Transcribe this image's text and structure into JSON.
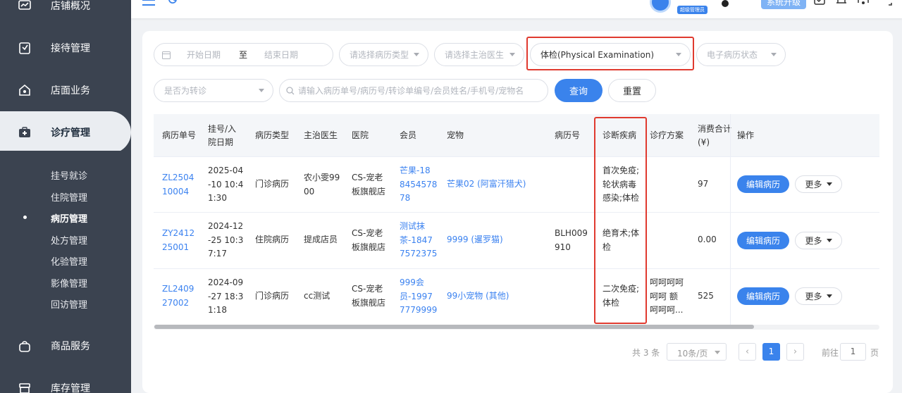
{
  "sidebar": {
    "items": [
      {
        "label": "店铺概况",
        "icon": "dashboard-icon"
      },
      {
        "label": "接待管理",
        "icon": "clipboard-icon"
      },
      {
        "label": "店面业务",
        "icon": "shop-icon"
      },
      {
        "label": "诊疗管理",
        "icon": "medical-kit-icon"
      },
      {
        "label": "商品服务",
        "icon": "bag-icon"
      },
      {
        "label": "库存管理",
        "icon": "box-icon"
      }
    ],
    "sub_items": [
      "挂号就诊",
      "住院管理",
      "病历管理",
      "处方管理",
      "化验管理",
      "影像管理",
      "回访管理"
    ]
  },
  "topbar": {
    "role_badge": "超级管理员",
    "upgrade_label": "系统升级"
  },
  "filters": {
    "start_date": "开始日期",
    "date_sep": "至",
    "end_date": "结束日期",
    "record_type": "请选择病历类型",
    "doctor": "请选择主治医生",
    "exam_type": "体检(Physical Examination)",
    "emr_status": "电子病历状态",
    "transfer": "是否为转诊",
    "search_placeholder": "请输入病历单号/病历号/转诊单编号/会员姓名/手机号/宠物名",
    "query_label": "查询",
    "reset_label": "重置"
  },
  "table": {
    "headers": {
      "record_no": "病历单号",
      "reg_date_1": "挂号/入",
      "reg_date_2": "院日期",
      "type": "病历类型",
      "doctor": "主治医生",
      "hospital": "医院",
      "member": "会员",
      "pet": "宠物",
      "case_no": "病历号",
      "diagnosis": "诊断疾病",
      "plan": "诊疗方案",
      "total_1": "消费合计",
      "total_2": "(¥)",
      "ops": "操作"
    },
    "rows": [
      {
        "record_no": [
          "ZL2504",
          "10004"
        ],
        "date": [
          "2025-04",
          "-10 10:4",
          "1:30"
        ],
        "type": "门诊病历",
        "doctor": [
          "农小雯99",
          "00"
        ],
        "hospital": [
          "CS-宠老",
          "板旗舰店"
        ],
        "member": [
          "芒果-18",
          "8454578",
          "78"
        ],
        "pet": "芒果02 (阿富汗猎犬)",
        "case_no": [
          "",
          ""
        ],
        "diagnosis": [
          "首次免疫;",
          "轮状病毒",
          "感染;体检"
        ],
        "plan": [
          "",
          "",
          ""
        ],
        "total": "97",
        "edit_label": "编辑病历",
        "more_label": "更多"
      },
      {
        "record_no": [
          "ZY2412",
          "25001"
        ],
        "date": [
          "2024-12",
          "-25 10:3",
          "7:17"
        ],
        "type": "住院病历",
        "doctor": [
          "提成店员",
          ""
        ],
        "hospital": [
          "CS-宠老",
          "板旗舰店"
        ],
        "member": [
          "测试抹",
          "茶-1847",
          "7572375"
        ],
        "pet": "9999 (暹罗猫)",
        "case_no": [
          "BLH009",
          "910"
        ],
        "diagnosis": [
          "绝育术;体",
          "检",
          ""
        ],
        "plan": [
          "",
          "",
          ""
        ],
        "total": "0.00",
        "edit_label": "编辑病历",
        "more_label": "更多"
      },
      {
        "record_no": [
          "ZL2409",
          "27002"
        ],
        "date": [
          "2024-09",
          "-27 18:3",
          "1:18"
        ],
        "type": "门诊病历",
        "doctor": [
          "cc测试",
          ""
        ],
        "hospital": [
          "CS-宠老",
          "板旗舰店"
        ],
        "member": [
          "999会",
          "员-1997",
          "7779999"
        ],
        "pet": "99小宠物 (其他)",
        "case_no": [
          "",
          ""
        ],
        "diagnosis": [
          "二次免疫;",
          "体检",
          ""
        ],
        "plan": [
          "呵呵呵呵",
          "呵呵 额",
          "呵呵呵..."
        ],
        "total": "525",
        "edit_label": "编辑病历",
        "more_label": "更多"
      }
    ]
  },
  "pagination": {
    "total_text": "共 3 条",
    "page_size": "10条/页",
    "current_page": "1",
    "goto_label": "前往",
    "goto_value": "1",
    "page_suffix": "页"
  },
  "colors": {
    "sidebar_bg": "#3b4350",
    "primary": "#3a83ec",
    "highlight_border": "#e03a2f",
    "link": "#3b82f0"
  }
}
